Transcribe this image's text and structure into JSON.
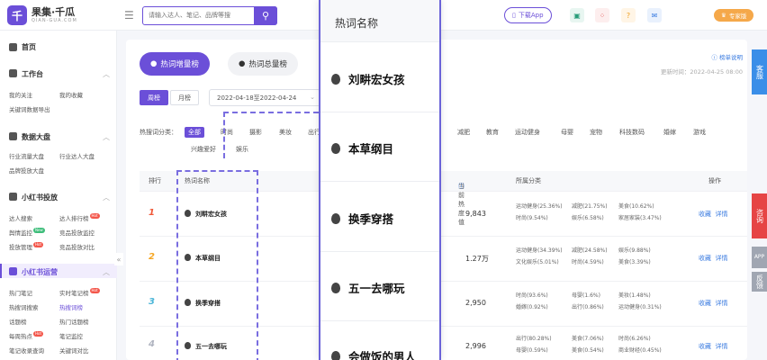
{
  "brand": {
    "name": "果集·千瓜",
    "sub": "QIAN-GUA.COM",
    "mark": "千"
  },
  "search": {
    "placeholder": "请输入达人、笔记、品牌等搜",
    "icon": "search-icon"
  },
  "header": {
    "download_label": "下载App",
    "vip_label": "专家版",
    "icons": [
      "store-icon",
      "apps-icon",
      "help-icon",
      "message-icon"
    ]
  },
  "sidebar": {
    "home": "首页",
    "sections": [
      {
        "title": "工作台",
        "items": [
          "我的关注",
          "我的收藏",
          "关键词数据导出"
        ]
      },
      {
        "title": "数据大盘",
        "items": [
          "行业流量大盘",
          "行业达人大盘",
          "品牌投放大盘"
        ]
      },
      {
        "title": "小红书投放",
        "items": [
          "达人搜索",
          "达人排行榜",
          "舆情监控",
          "竞品投放监控",
          "投放管理",
          "竞品投放对比"
        ]
      },
      {
        "title": "小红书运营",
        "items": [
          "热门笔记",
          "实时笔记榜",
          "热搜词搜索",
          "热搜词榜",
          "话题榜",
          "热门话题榜",
          "每周热点",
          "笔记监控",
          "笔记收录查询",
          "关键词对比"
        ]
      }
    ],
    "badge_hot": "Hot",
    "badge_new": "New"
  },
  "main": {
    "tabs": [
      "热词增量榜",
      "热词总量榜"
    ],
    "hint_link": "榜单说明",
    "updated": "更新时间：2022-04-25 08:00",
    "period": [
      "周榜",
      "月榜"
    ],
    "date_range": "2022-04-18至2022-04-24",
    "category_label": "热搜词分类：",
    "categories_row1": [
      "全部",
      "时尚",
      "摄影",
      "美妆",
      "出行",
      "减肥",
      "教育",
      "运动健身",
      "母婴",
      "宠物",
      "科技数码",
      "婚嫁",
      "游戏"
    ],
    "categories_row2": [
      "兴趣爱好",
      "娱乐"
    ],
    "table_headers": {
      "rank": "排行",
      "keyword": "热词名称",
      "heat": "当前热度值",
      "category": "所属分类",
      "actions": "操作"
    },
    "rows": [
      {
        "rank": "1",
        "keyword": "刘畊宏女孩",
        "heat": "9,843",
        "cats": [
          "运动健身(25.36%)",
          "减肥(21.75%)",
          "美食(10.62%)",
          "时尚(9.54%)",
          "娱乐(6.58%)",
          "家居家装(3.47%)"
        ]
      },
      {
        "rank": "2",
        "keyword": "本草纲目",
        "heat": "1.27万",
        "cats": [
          "运动健身(34.39%)",
          "减肥(24.58%)",
          "娱乐(9.88%)",
          "文化娱乐(5.01%)",
          "时尚(4.59%)",
          "美食(3.39%)"
        ]
      },
      {
        "rank": "3",
        "keyword": "换季穿搭",
        "heat": "2,950",
        "cats": [
          "时尚(93.6%)",
          "母婴(1.6%)",
          "美妆(1.48%)",
          "婚嫁(0.92%)",
          "出行(0.86%)",
          "运动健身(0.31%)"
        ]
      },
      {
        "rank": "4",
        "keyword": "五一去哪玩",
        "heat": "2,996",
        "cats": [
          "出行(80.28%)",
          "美食(7.06%)",
          "时尚(6.26%)",
          "母婴(0.59%)",
          "美食(0.54%)",
          "商业财经(0.45%)"
        ]
      }
    ],
    "row_actions": [
      "收藏",
      "详情"
    ]
  },
  "overlay": {
    "header": "热词名称",
    "keywords": [
      "刘畊宏女孩",
      "本草纲目",
      "换季穿搭",
      "五一去哪玩",
      "会做饭的男人"
    ]
  },
  "right_bar": [
    "客服",
    "咨询",
    "APP",
    "反馈"
  ],
  "colors": {
    "brand": "#6b4fd8",
    "link": "#3a7be0",
    "vip": "#f5a84a",
    "rank1": "#f05a3a",
    "rank2": "#f5a623",
    "rank3": "#4cb6d8",
    "rank4": "#b0b4c0"
  }
}
